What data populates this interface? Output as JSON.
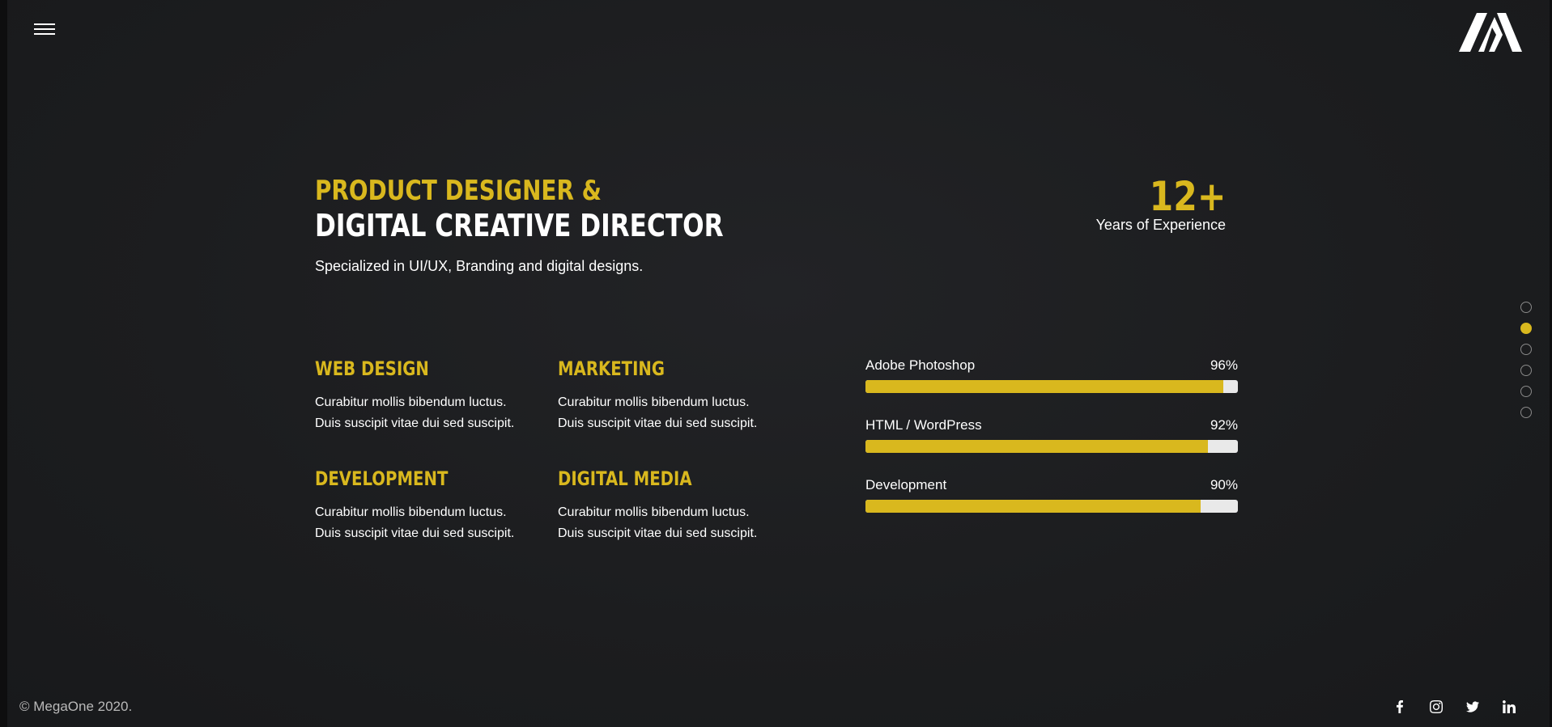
{
  "header": {
    "menu_icon": "hamburger-icon",
    "logo_icon": "megaone-logo"
  },
  "hero": {
    "title_line1": "PRODUCT DESIGNER &",
    "title_line2": "DIGITAL CREATIVE DIRECTOR",
    "subtitle": "Specialized in UI/UX, Branding and digital designs."
  },
  "experience": {
    "number": "12+",
    "label": "Years of Experience"
  },
  "services": [
    {
      "title": "WEB DESIGN",
      "line1": "Curabitur mollis bibendum luctus.",
      "line2": "Duis suscipit vitae dui sed suscipit."
    },
    {
      "title": "MARKETING",
      "line1": "Curabitur mollis bibendum luctus.",
      "line2": "Duis suscipit vitae dui sed suscipit."
    },
    {
      "title": "DEVELOPMENT",
      "line1": "Curabitur mollis bibendum luctus.",
      "line2": "Duis suscipit vitae dui sed suscipit."
    },
    {
      "title": "DIGITAL MEDIA",
      "line1": "Curabitur mollis bibendum luctus.",
      "line2": "Duis suscipit vitae dui sed suscipit."
    }
  ],
  "skills": [
    {
      "name": "Adobe Photoshop",
      "percent_label": "96%",
      "value": 96
    },
    {
      "name": "HTML / WordPress",
      "percent_label": "92%",
      "value": 92
    },
    {
      "name": "Development",
      "percent_label": "90%",
      "value": 90
    }
  ],
  "dots": {
    "count": 6,
    "active_index": 1
  },
  "footer": {
    "copyright": "© MegaOne 2020.",
    "social_icons": [
      "facebook-icon",
      "instagram-icon",
      "twitter-icon",
      "linkedin-icon"
    ]
  },
  "colors": {
    "accent": "#d9b81e",
    "background": "#1b1c1e",
    "bar_track": "#e9e9e9"
  }
}
